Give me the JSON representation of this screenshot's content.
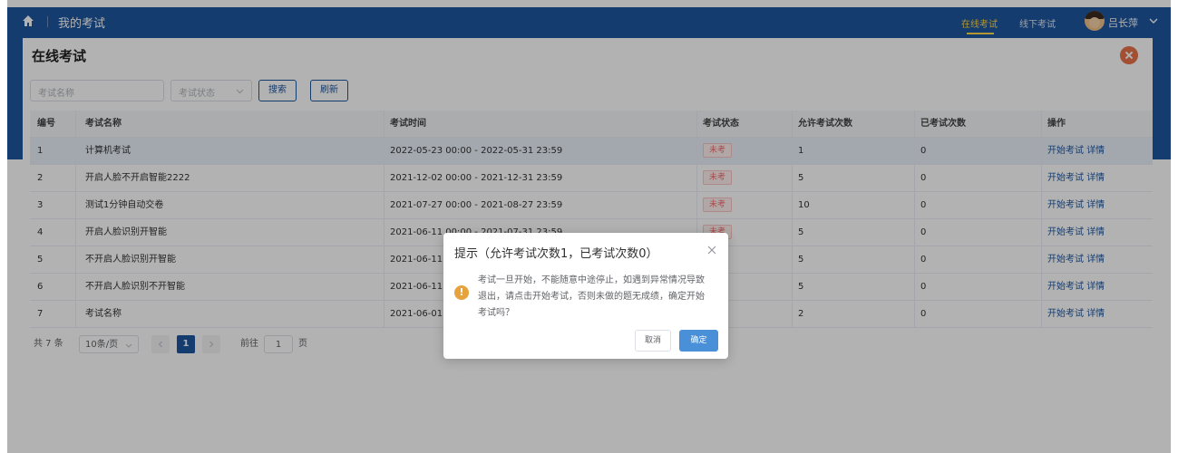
{
  "header": {
    "title": "我的考试",
    "nav": [
      "在线考试",
      "线下考试"
    ],
    "active_nav": "在线考试",
    "username": "吕长萍",
    "accent_color": "#1e56a0",
    "active_color": "#ffd84a"
  },
  "page": {
    "title": "在线考试"
  },
  "filter": {
    "name_placeholder": "考试名称",
    "status_placeholder": "考试状态",
    "search_label": "搜索",
    "refresh_label": "刷新"
  },
  "table": {
    "columns": [
      "编号",
      "考试名称",
      "考试时间",
      "考试状态",
      "允许考试次数",
      "已考试次数",
      "操作"
    ],
    "rows": [
      {
        "no": "1",
        "name": "计算机考试",
        "time": "2022-05-23 00:00 - 2022-05-31 23:59",
        "status": "未考",
        "allowed": "1",
        "taken": "0"
      },
      {
        "no": "2",
        "name": "开启人脸不开启智能2222",
        "time": "2021-12-02 00:00 - 2021-12-31 23:59",
        "status": "未考",
        "allowed": "5",
        "taken": "0"
      },
      {
        "no": "3",
        "name": "测试1分钟自动交卷",
        "time": "2021-07-27 00:00 - 2021-08-27 23:59",
        "status": "未考",
        "allowed": "10",
        "taken": "0"
      },
      {
        "no": "4",
        "name": "开启人脸识别开智能",
        "time": "2021-06-11 00:00 - 2021-07-31 23:59",
        "status": "未考",
        "allowed": "5",
        "taken": "0"
      },
      {
        "no": "5",
        "name": "不开启人脸识别开智能",
        "time": "2021-06-11 0",
        "status": "",
        "allowed": "5",
        "taken": "0"
      },
      {
        "no": "6",
        "name": "不开启人脸识别不开智能",
        "time": "2021-06-11 0",
        "status": "",
        "allowed": "5",
        "taken": "0"
      },
      {
        "no": "7",
        "name": "考试名称",
        "time": "2021-06-01 0",
        "status": "",
        "allowed": "2",
        "taken": "0"
      }
    ],
    "action_start": "开始考试",
    "action_detail": "详情"
  },
  "pager": {
    "total": "共 7 条",
    "page_size": "10条/页",
    "current_page": "1",
    "goto_prefix": "前往",
    "goto_value": "1",
    "goto_suffix": "页"
  },
  "dialog": {
    "title": "提示（允许考试次数1，已考试次数0）",
    "message": "考试一旦开始，不能随意中途停止，如遇到异常情况导致退出，请点击开始考试，否则未做的题无成绩，确定开始考试吗？",
    "cancel_label": "取消",
    "ok_label": "确定",
    "warn_color": "#e6a23c"
  }
}
